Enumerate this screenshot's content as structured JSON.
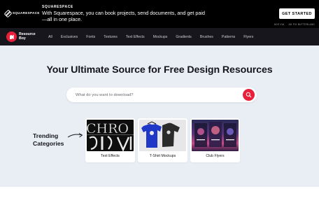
{
  "ad": {
    "logo_text": "SQUARESPACE",
    "brand": "SQUARESPACE",
    "copy": "With Squarespace, you can book projects, send documents, and get paid—all in one place.",
    "cta": "GET STARTED",
    "footer_links": [
      "ADS VIA",
      "AD FIX BUTTERLAND"
    ]
  },
  "nav": {
    "brand_text": "Resource Boy",
    "items": [
      "All",
      "Exclusives",
      "Fonts",
      "Textures",
      "Text Effects",
      "Mockups",
      "Gradients",
      "Brushes",
      "Patterns",
      "Flyers"
    ]
  },
  "hero": {
    "title": "Your Ultimate Source for Free Design Resources",
    "search_placeholder": "What do you want to download?"
  },
  "trending": {
    "heading_line1": "Trending",
    "heading_line2": "Categories",
    "cards": [
      {
        "label": "Text Effects",
        "thumb_text": "CHRO"
      },
      {
        "label": "T-Shirt Mockups"
      },
      {
        "label": "Club Flyers"
      }
    ]
  },
  "colors": {
    "accent": "#e8203b",
    "nav_bg": "#16161c",
    "hero_bg": "#e8eef4"
  }
}
